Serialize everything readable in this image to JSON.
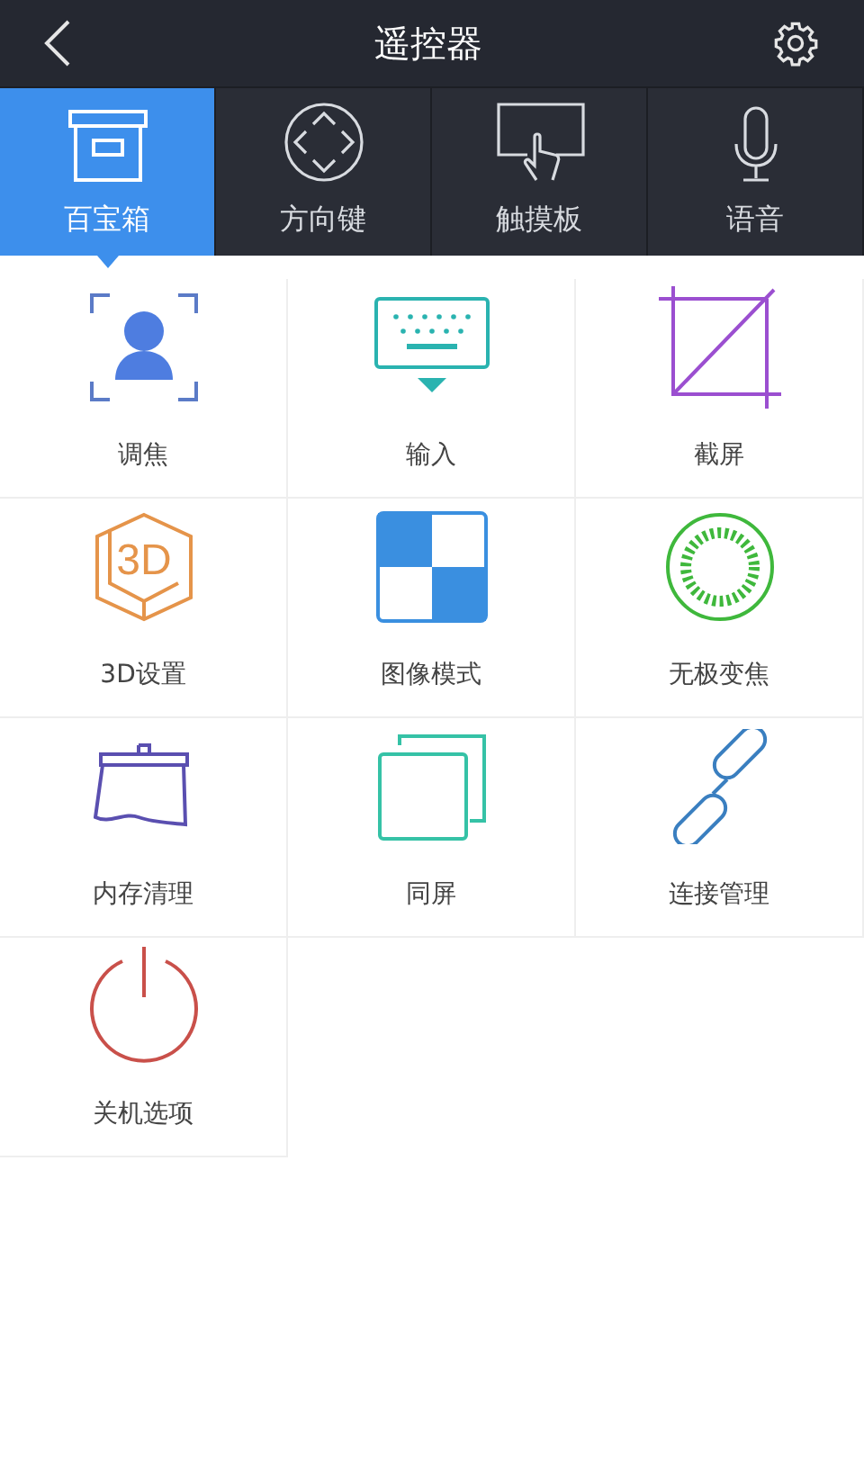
{
  "header": {
    "title": "遥控器"
  },
  "tabs": [
    {
      "label": "百宝箱",
      "kind": "box",
      "selected": true
    },
    {
      "label": "方向键",
      "kind": "dpad",
      "selected": false
    },
    {
      "label": "触摸板",
      "kind": "touchpad",
      "selected": false
    },
    {
      "label": "语音",
      "kind": "mic",
      "selected": false
    }
  ],
  "tools": [
    {
      "label": "调焦",
      "kind": "focus"
    },
    {
      "label": "输入",
      "kind": "keyboard"
    },
    {
      "label": "截屏",
      "kind": "crop"
    },
    {
      "label": "3D设置",
      "kind": "cube",
      "icon_text": "3D"
    },
    {
      "label": "图像模式",
      "kind": "checker"
    },
    {
      "label": "无极变焦",
      "kind": "dial"
    },
    {
      "label": "内存清理",
      "kind": "sweep"
    },
    {
      "label": "同屏",
      "kind": "mirror"
    },
    {
      "label": "连接管理",
      "kind": "link"
    },
    {
      "label": "关机选项",
      "kind": "power"
    }
  ]
}
